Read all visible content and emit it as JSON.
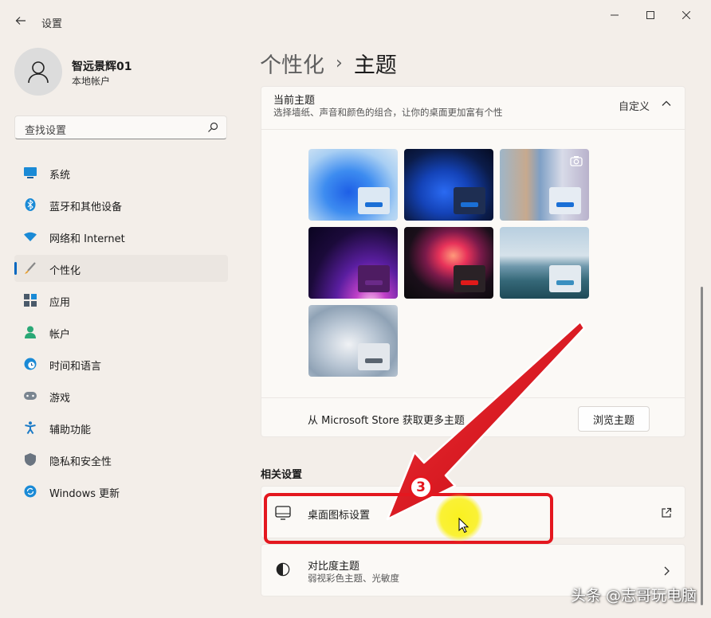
{
  "app": {
    "title": "设置"
  },
  "window": {
    "minimize_icon": "minimize-icon",
    "maximize_icon": "maximize-icon",
    "close_icon": "close-icon"
  },
  "user": {
    "name": "智远景辉01",
    "account_type": "本地帐户"
  },
  "search": {
    "placeholder": "查找设置"
  },
  "sidebar": {
    "items": [
      {
        "label": "系统",
        "icon": "monitor-icon",
        "active": false
      },
      {
        "label": "蓝牙和其他设备",
        "icon": "bluetooth-icon",
        "active": false
      },
      {
        "label": "网络和 Internet",
        "icon": "wifi-icon",
        "active": false
      },
      {
        "label": "个性化",
        "icon": "brush-icon",
        "active": true
      },
      {
        "label": "应用",
        "icon": "apps-icon",
        "active": false
      },
      {
        "label": "帐户",
        "icon": "person-icon",
        "active": false
      },
      {
        "label": "时间和语言",
        "icon": "clock-globe-icon",
        "active": false
      },
      {
        "label": "游戏",
        "icon": "gamepad-icon",
        "active": false
      },
      {
        "label": "辅助功能",
        "icon": "accessibility-icon",
        "active": false
      },
      {
        "label": "隐私和安全性",
        "icon": "shield-icon",
        "active": false
      },
      {
        "label": "Windows 更新",
        "icon": "update-icon",
        "active": false
      }
    ]
  },
  "header": {
    "parent": "个性化",
    "separator": "›",
    "current": "主题"
  },
  "current_theme": {
    "title": "当前主题",
    "subtitle": "选择墙纸、声音和颜色的组合，让你的桌面更加富有个性",
    "state": "自定义",
    "store_text": "从 Microsoft Store 获取更多主题",
    "browse_label": "浏览主题"
  },
  "related": {
    "title": "相关设置",
    "desktop_icons": {
      "label": "桌面图标设置"
    },
    "contrast": {
      "label": "对比度主题",
      "sublabel": "弱视彩色主题、光敏度"
    }
  },
  "annotation": {
    "step": "3",
    "watermark": "头条 @志哥玩电脑"
  },
  "colors": {
    "accent": "#0067c0",
    "annotation_red": "#e4171f",
    "cursor_highlight": "#f5ee10"
  }
}
